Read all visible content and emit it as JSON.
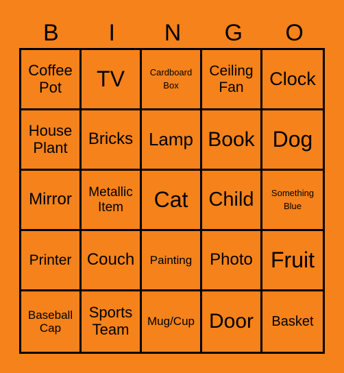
{
  "header": [
    "B",
    "I",
    "N",
    "G",
    "O"
  ],
  "cells": [
    "Coffee Pot",
    "TV",
    "Cardboard Box",
    "Ceiling Fan",
    "Clock",
    "House Plant",
    "Bricks",
    "Lamp",
    "Book",
    "Dog",
    "Mirror",
    "Metallic Item",
    "Cat",
    "Child",
    "Something Blue",
    "Printer",
    "Couch",
    "Painting",
    "Photo",
    "Fruit",
    "Baseball Cap",
    "Sports Team",
    "Mug/Cup",
    "Door",
    "Basket"
  ],
  "colors": {
    "background": "#F5821A",
    "grid_lines": "#000000",
    "text": "#000000"
  }
}
